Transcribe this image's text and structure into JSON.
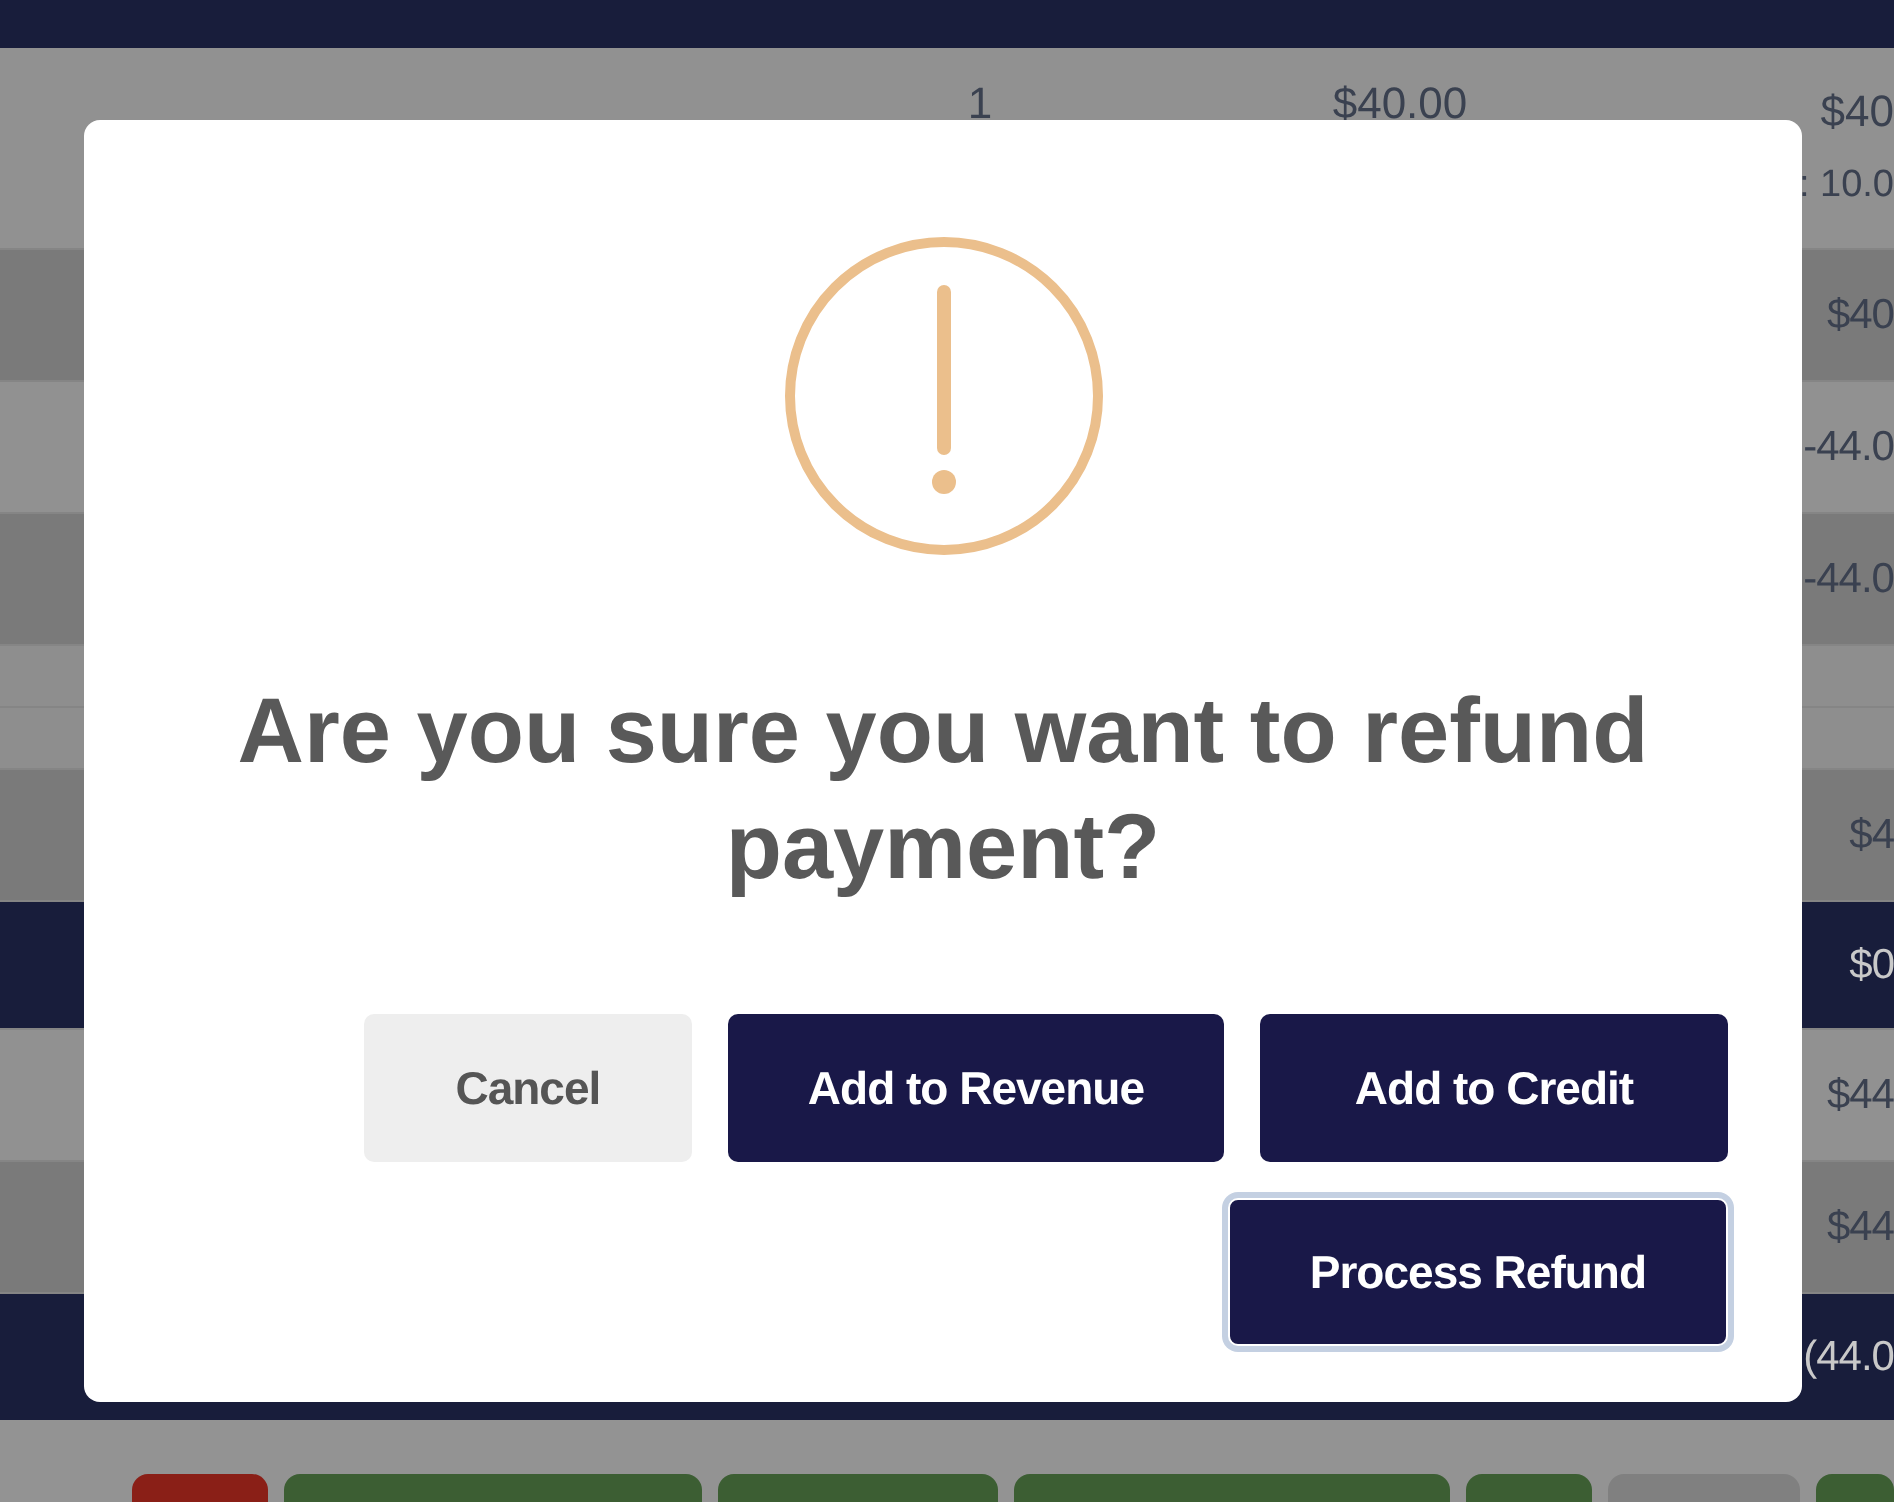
{
  "rows": [
    {
      "kind": "light",
      "cells": [
        "1",
        "$40.00"
      ],
      "amount": "$40",
      "note": ": 10.0"
    },
    {
      "kind": "dark",
      "amount": "$40"
    },
    {
      "kind": "light",
      "amount": "-44.0"
    },
    {
      "kind": "dark",
      "amount": "-44.0"
    },
    {
      "kind": "spacer"
    },
    {
      "kind": "spacer"
    },
    {
      "kind": "dark",
      "amount": "$4"
    },
    {
      "kind": "navy",
      "amount": "$0"
    },
    {
      "kind": "light",
      "amount": "$44"
    },
    {
      "kind": "dark",
      "amount": "$44"
    },
    {
      "kind": "navy",
      "amount": "(44.0"
    }
  ],
  "footer_buttons": [
    {
      "color": "#8a1f17"
    },
    {
      "color": "#3c5e33"
    },
    {
      "color": "#3c5e33"
    },
    {
      "color": "#3c5e33"
    },
    {
      "color": "#3c5e33"
    },
    {
      "color": "#808080"
    },
    {
      "color": "#3c5e33"
    }
  ],
  "dialog": {
    "title": "Are you sure you want to refund payment?",
    "buttons": [
      {
        "label": "Cancel",
        "kind": "secondary",
        "focused": false
      },
      {
        "label": "Add to Revenue",
        "kind": "primary",
        "focused": false
      },
      {
        "label": "Add to Credit",
        "kind": "primary",
        "focused": false
      },
      {
        "label": "Process Refund",
        "kind": "primary",
        "focused": true
      }
    ]
  }
}
